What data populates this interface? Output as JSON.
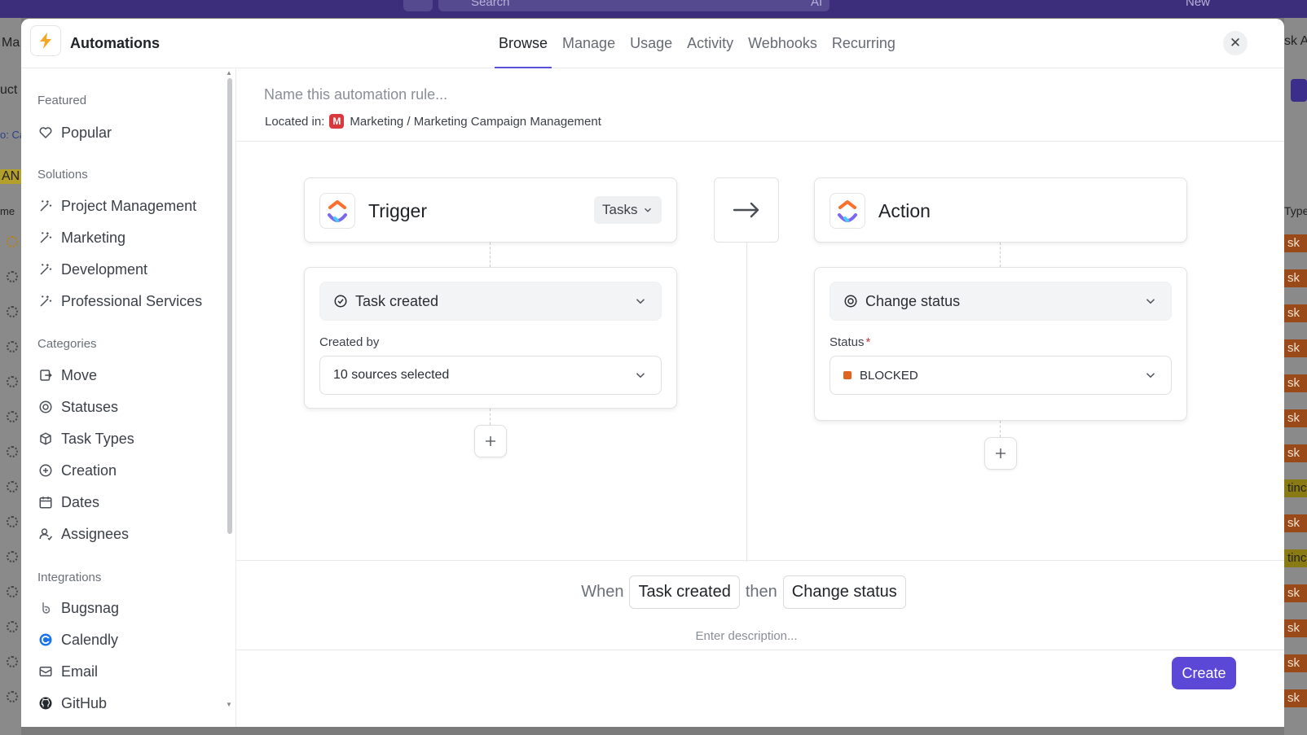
{
  "header": {
    "title": "Automations",
    "tabs": [
      {
        "label": "Browse",
        "active": true
      },
      {
        "label": "Manage"
      },
      {
        "label": "Usage"
      },
      {
        "label": "Activity"
      },
      {
        "label": "Webhooks"
      },
      {
        "label": "Recurring"
      }
    ],
    "close_glyph": "✕"
  },
  "background": {
    "topbar": {
      "search": "Search",
      "ai": "AI",
      "new": "New"
    },
    "left_snippets": [
      "Ma",
      "uct",
      "o: Ca",
      "AN",
      "me"
    ],
    "right_snippets": [
      "sk A",
      "Type",
      "sk",
      "tinc"
    ]
  },
  "sidebar": {
    "sections": [
      {
        "title": "Featured",
        "items": [
          {
            "label": "Popular",
            "icon": "heart-icon"
          }
        ]
      },
      {
        "title": "Solutions",
        "items": [
          {
            "label": "Project Management",
            "icon": "magic-wand-icon"
          },
          {
            "label": "Marketing",
            "icon": "magic-wand-icon"
          },
          {
            "label": "Development",
            "icon": "magic-wand-icon"
          },
          {
            "label": "Professional Services",
            "icon": "magic-wand-icon"
          }
        ]
      },
      {
        "title": "Categories",
        "items": [
          {
            "label": "Move",
            "icon": "move-icon"
          },
          {
            "label": "Statuses",
            "icon": "status-icon"
          },
          {
            "label": "Task Types",
            "icon": "cube-icon"
          },
          {
            "label": "Creation",
            "icon": "plus-circle-icon"
          },
          {
            "label": "Dates",
            "icon": "calendar-icon"
          },
          {
            "label": "Assignees",
            "icon": "assignees-icon"
          }
        ]
      },
      {
        "title": "Integrations",
        "items": [
          {
            "label": "Bugsnag",
            "icon": "bugsnag-icon"
          },
          {
            "label": "Calendly",
            "icon": "calendly-icon"
          },
          {
            "label": "Email",
            "icon": "email-icon"
          },
          {
            "label": "GitHub",
            "icon": "github-icon"
          }
        ]
      }
    ]
  },
  "rule": {
    "name_placeholder": "Name this automation rule...",
    "located_label": "Located in:",
    "location_badge": "M",
    "location_path": "Marketing / Marketing Campaign Management"
  },
  "trigger": {
    "title": "Trigger",
    "scope": "Tasks",
    "event": "Task created",
    "created_by_label": "Created by",
    "created_by_value": "10 sources selected"
  },
  "action": {
    "title": "Action",
    "event": "Change status",
    "status_label": "Status",
    "required_mark": "*",
    "status_value": "BLOCKED",
    "status_color": "#e0641f"
  },
  "summary": {
    "when": "When",
    "trigger": "Task created",
    "then": "then",
    "action": "Change status",
    "description_placeholder": "Enter description..."
  },
  "footer": {
    "create_label": "Create"
  },
  "colors": {
    "accent": "#5b48d6",
    "location_badge": "#d9383c"
  }
}
